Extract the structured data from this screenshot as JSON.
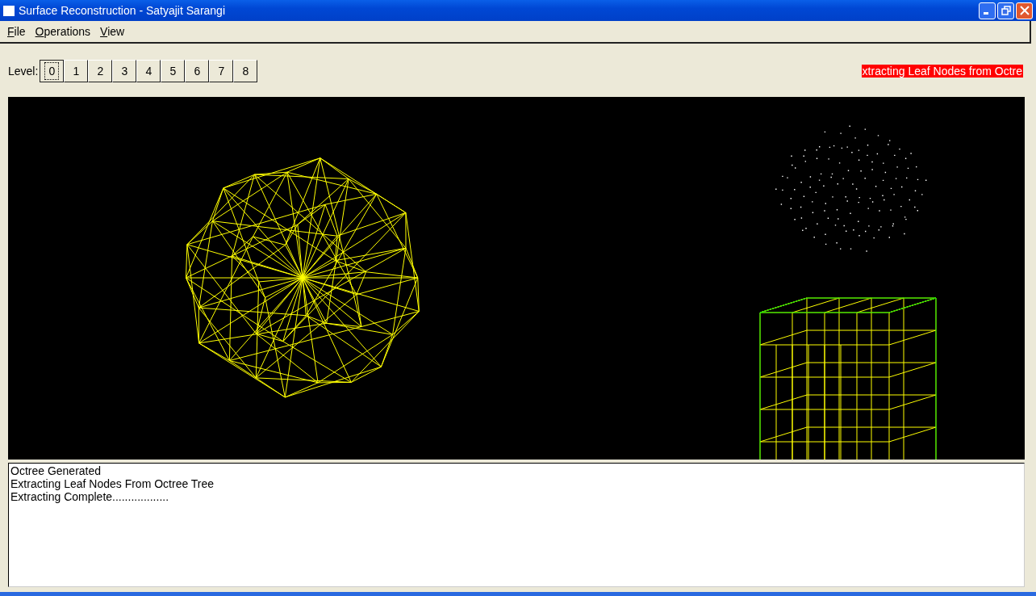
{
  "window": {
    "title": "Surface Reconstruction - Satyajit Sarangi"
  },
  "menu": [
    {
      "label": "File"
    },
    {
      "label": "Operations"
    },
    {
      "label": "View"
    }
  ],
  "level_label": "Level:",
  "levels": [
    {
      "label": "0",
      "selected": true
    },
    {
      "label": "1",
      "selected": false
    },
    {
      "label": "2",
      "selected": false
    },
    {
      "label": "3",
      "selected": false
    },
    {
      "label": "4",
      "selected": false
    },
    {
      "label": "5",
      "selected": false
    },
    {
      "label": "6",
      "selected": false
    },
    {
      "label": "7",
      "selected": false
    },
    {
      "label": "8",
      "selected": false
    }
  ],
  "status_banner": "xtracting Leaf Nodes from Octre",
  "log": [
    "Octree Generated",
    "Extracting Leaf Nodes From Octree Tree",
    "Extracting Complete.................."
  ]
}
